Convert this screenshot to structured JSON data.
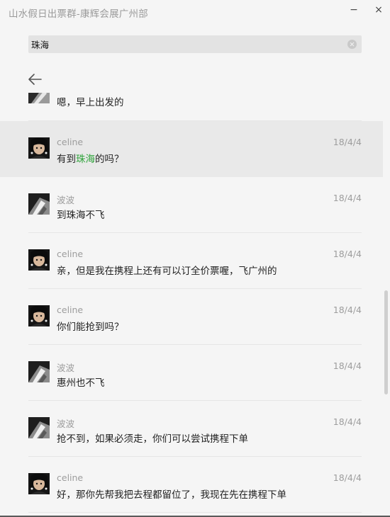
{
  "window": {
    "title": "山水假日出票群-康辉会展广州部",
    "minimize_symbol": "−",
    "close_symbol": "×"
  },
  "search": {
    "value": "珠海",
    "clear_icon": "clear-circle-icon"
  },
  "back_icon": "back-arrow-icon",
  "partial_message": {
    "text": "嗯，早上出发的"
  },
  "messages": [
    {
      "sender": "celine",
      "date": "18/4/4",
      "text_before": "有到",
      "text_match": "珠海",
      "text_after": "的吗？"
    },
    {
      "sender": "波波",
      "date": "18/4/4",
      "text": "到珠海不飞"
    },
    {
      "sender": "celine",
      "date": "18/4/4",
      "text": "亲，但是我在携程上还有可以订全价票喔，飞广州的"
    },
    {
      "sender": "celine",
      "date": "18/4/4",
      "text": "你们能抢到吗？"
    },
    {
      "sender": "波波",
      "date": "18/4/4",
      "text": "惠州也不飞"
    },
    {
      "sender": "波波",
      "date": "18/4/4",
      "text": "抢不到，如果必须走，你们可以尝试携程下单"
    },
    {
      "sender": "celine",
      "date": "18/4/4",
      "text": "好，那你先帮我把去程都留位了，我现在先在携程下单"
    }
  ],
  "colors": {
    "highlight": "#2fa33b",
    "background": "#f5f5f5",
    "active_row": "#e9e9e9"
  }
}
